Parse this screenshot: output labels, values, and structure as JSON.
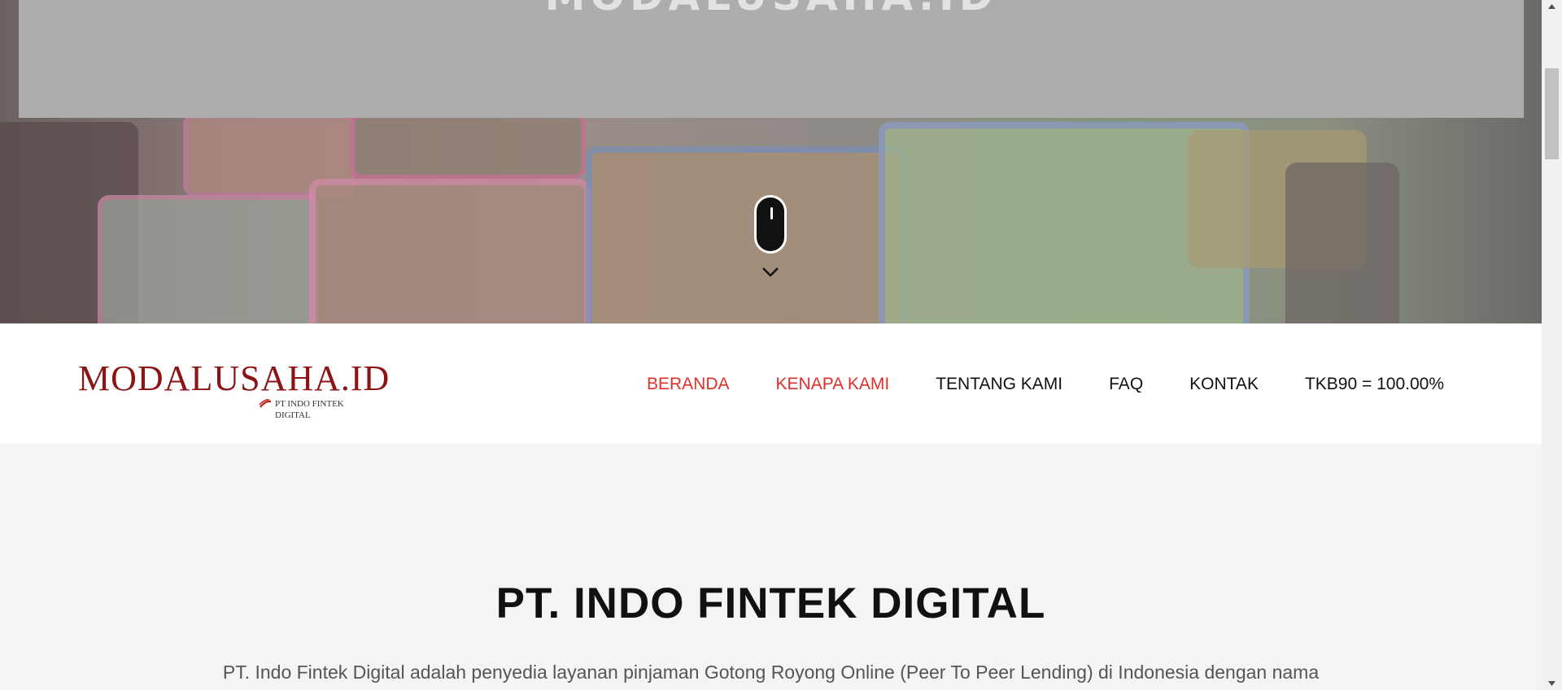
{
  "hero": {
    "band_title": "MODALUSAHA.ID",
    "scroll_hint_icon": "mouse-scroll-icon",
    "chevron_icon": "chevron-down-icon"
  },
  "nav": {
    "logo_text": "MODALUSAHA.ID",
    "logo_subtitle": "PT INDO FINTEK DIGITAL",
    "items": [
      {
        "label": "BERANDA",
        "active": true
      },
      {
        "label": "KENAPA KAMI",
        "active": true
      },
      {
        "label": "TENTANG KAMI",
        "active": false
      },
      {
        "label": "FAQ",
        "active": false
      },
      {
        "label": "KONTAK",
        "active": false
      },
      {
        "label": "TKB90 = 100.00%",
        "active": false
      }
    ]
  },
  "main": {
    "title": "PT. INDO FINTEK DIGITAL",
    "intro": "PT. Indo Fintek Digital adalah penyedia layanan pinjaman Gotong Royong Online (Peer To Peer Lending) di Indonesia dengan nama"
  },
  "colors": {
    "accent": "#e0302a",
    "logo": "#8b1515",
    "text": "#111111",
    "band": "#adadad"
  }
}
